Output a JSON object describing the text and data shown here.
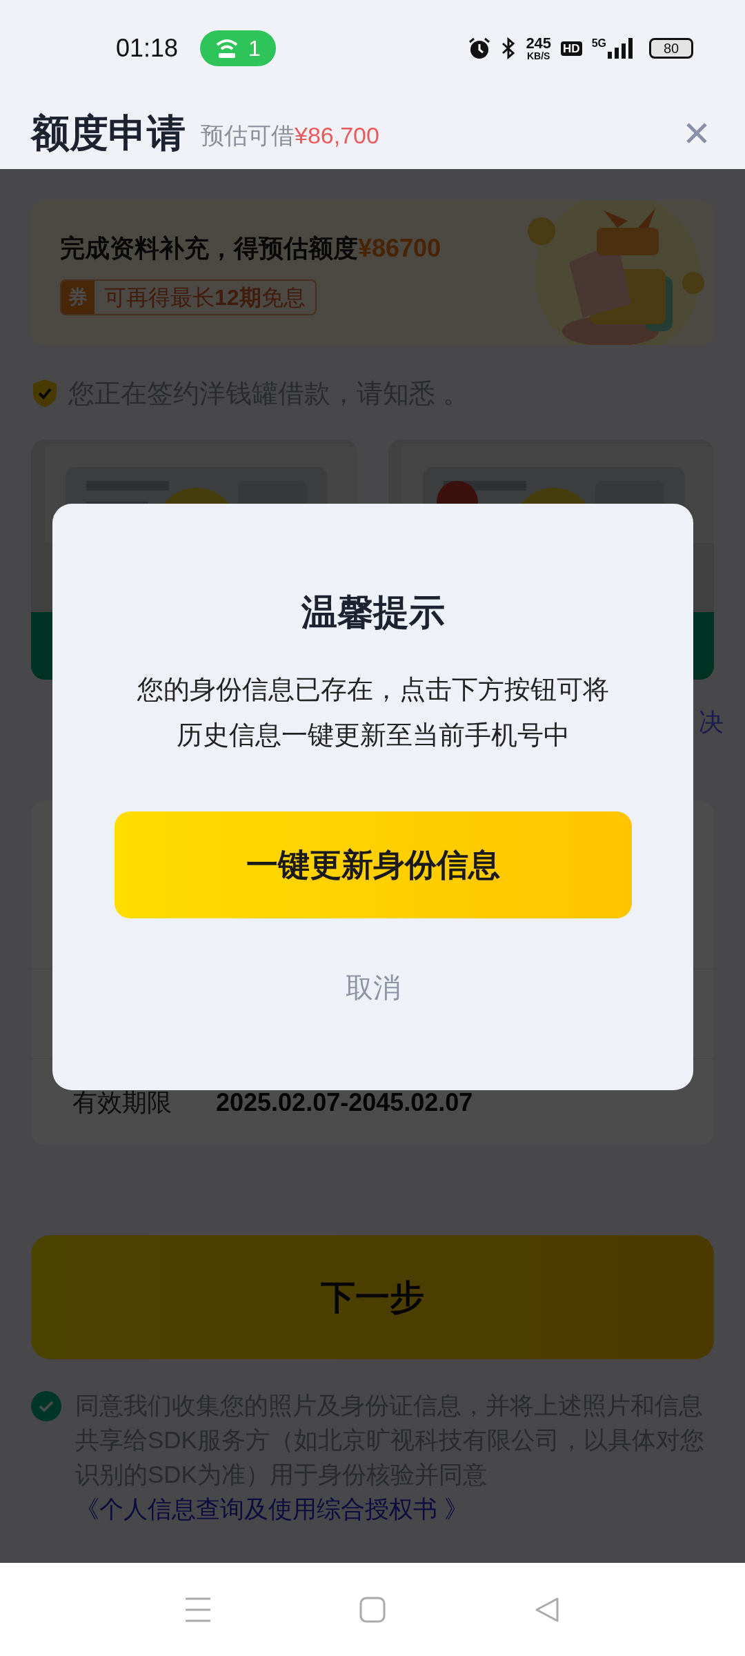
{
  "status_bar": {
    "time": "01:18",
    "hotspot_count": "1",
    "network_speed": "245",
    "network_speed_unit": "KB/S",
    "hd_badge": "HD",
    "network_type": "5G",
    "battery": "80"
  },
  "header": {
    "title": "额度申请",
    "subtitle": "预估可借",
    "amount": "¥86,700"
  },
  "banner": {
    "headline": "完成资料补充，得预估额度",
    "amount": "¥86700",
    "coupon_badge": "券",
    "coupon_text": "可再得最长**12期**免息"
  },
  "notice": "您正在签约洋钱罐借款，请知悉 。",
  "side_link_fragment": "决",
  "form": {
    "rows": [
      {
        "label": "有效期限",
        "value": "2025.02.07-2045.02.07"
      }
    ]
  },
  "next_button": "下一步",
  "agreement": {
    "checked": true,
    "text": "同意我们收集您的照片及身份证信息，并将上述照片和信息共享给SDK服务方（如北京旷视科技有限公司，以具体对您识别的SDK为准）用于身份核验并同意",
    "link": "《个人信息查询及使用综合授权书 》"
  },
  "dialog": {
    "title": "温馨提示",
    "message": "您的身份信息已存在，点击下方按钮可将历史信息一键更新至当前手机号中",
    "confirm": "一键更新身份信息",
    "cancel": "取消"
  }
}
